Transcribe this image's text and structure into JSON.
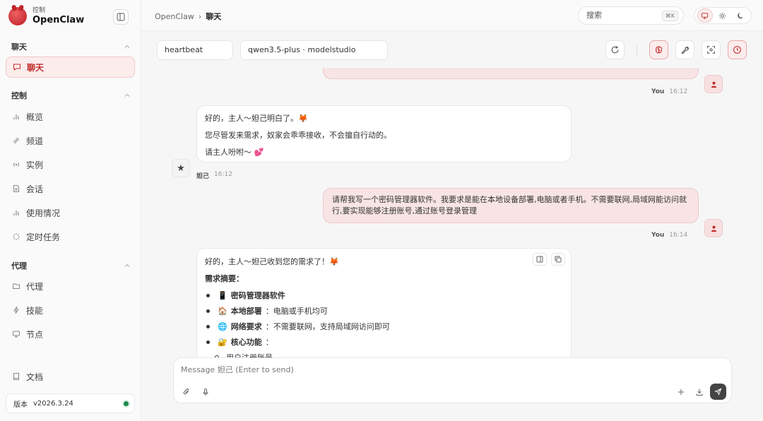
{
  "sidebar": {
    "brand_sub": "控制",
    "brand_name": "OpenClaw",
    "sections": {
      "chat": {
        "title": "聊天",
        "items": [
          {
            "label": "聊天"
          }
        ]
      },
      "control": {
        "title": "控制",
        "items": [
          {
            "label": "概览"
          },
          {
            "label": "频道"
          },
          {
            "label": "实例"
          },
          {
            "label": "会话"
          },
          {
            "label": "使用情况"
          },
          {
            "label": "定时任务"
          }
        ]
      },
      "agent": {
        "title": "代理",
        "items": [
          {
            "label": "代理"
          },
          {
            "label": "技能"
          },
          {
            "label": "节点"
          }
        ]
      }
    },
    "docs_label": "文档",
    "version_label": "版本",
    "version_value": "v2026.3.24"
  },
  "topbar": {
    "breadcrumb_root": "OpenClaw",
    "breadcrumb_sep": "›",
    "breadcrumb_current": "聊天",
    "search_label": "搜索",
    "search_shortcut": "⌘K"
  },
  "toolbar": {
    "session": "heartbeat",
    "model": "qwen3.5-plus · modelstudio"
  },
  "messages": {
    "m1": {
      "author": "You",
      "time": "16:12"
    },
    "m2": {
      "lines": [
        "好的，主人～妲己明白了。🦊",
        "您尽管发来需求，奴家会乖乖接收，不会擅自行动的。",
        "请主人吩咐～ 💕"
      ],
      "author": "妲己",
      "time": "16:12"
    },
    "m3": {
      "text": "请帮我写一个密码管理器软件。我要求是能在本地设备部署,电脑或者手机。不需要联网,局域网能访问就行,要实现能够注册账号,通过账号登录管理",
      "author": "You",
      "time": "16:14"
    },
    "m4": {
      "intro": "好的，主人～妲己收到您的需求了！🦊",
      "summary_title": "需求摘要：",
      "bullets": [
        {
          "emoji": "📱",
          "bold": "密码管理器软件",
          "rest": ""
        },
        {
          "emoji": "🏠",
          "bold": "本地部署",
          "rest": "：电脑或手机均可"
        },
        {
          "emoji": "🌐",
          "bold": "网络要求",
          "rest": "：不需要联网，支持局域网访问即可"
        },
        {
          "emoji": "🔐",
          "bold": "核心功能",
          "rest": "："
        }
      ],
      "sub_bullets": [
        "用户注册账号"
      ]
    }
  },
  "composer": {
    "placeholder": "Message 妲己 (Enter to send)"
  },
  "colors": {
    "accent": "#c22b2b",
    "accent_bg": "#fcecec",
    "user_bubble": "#f8e4e4",
    "status_online": "#1f8a4c"
  }
}
